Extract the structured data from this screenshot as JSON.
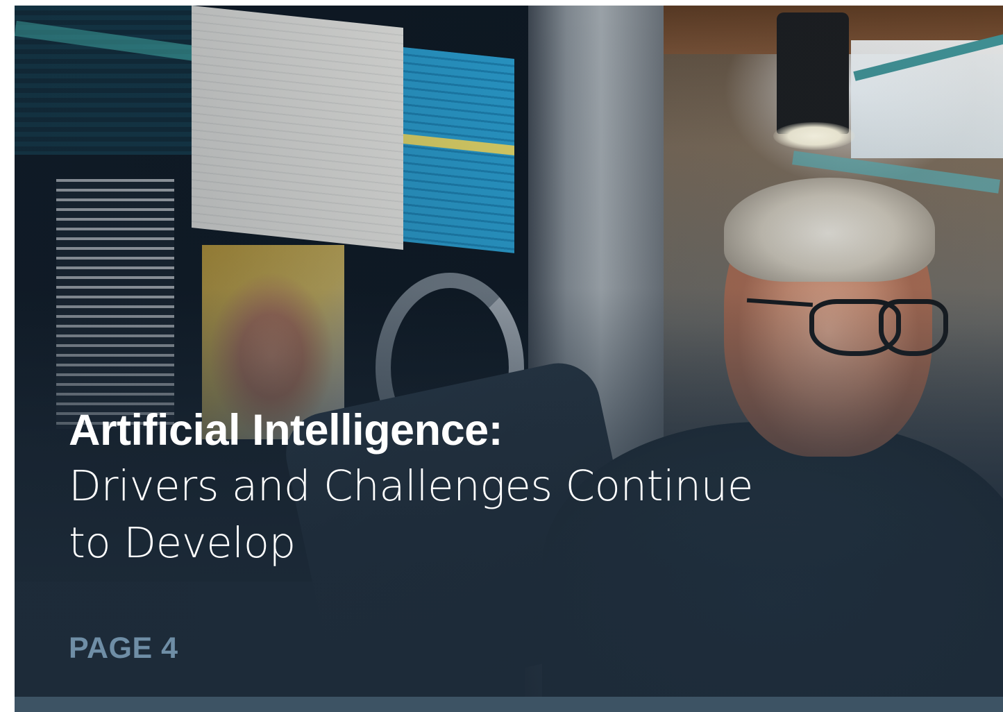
{
  "cover": {
    "title_bold": "Artificial Intelligence:",
    "title_rest": "Drivers and Challenges Continue to Develop",
    "page_label": "PAGE 4"
  },
  "colors": {
    "page_label": "#6f8ea6",
    "footer_bar": "#3d5364",
    "overlay": "#1d2b39",
    "title_text": "#ffffff"
  },
  "image": {
    "subject": "presenter-gesturing-at-dashboard-screen"
  }
}
